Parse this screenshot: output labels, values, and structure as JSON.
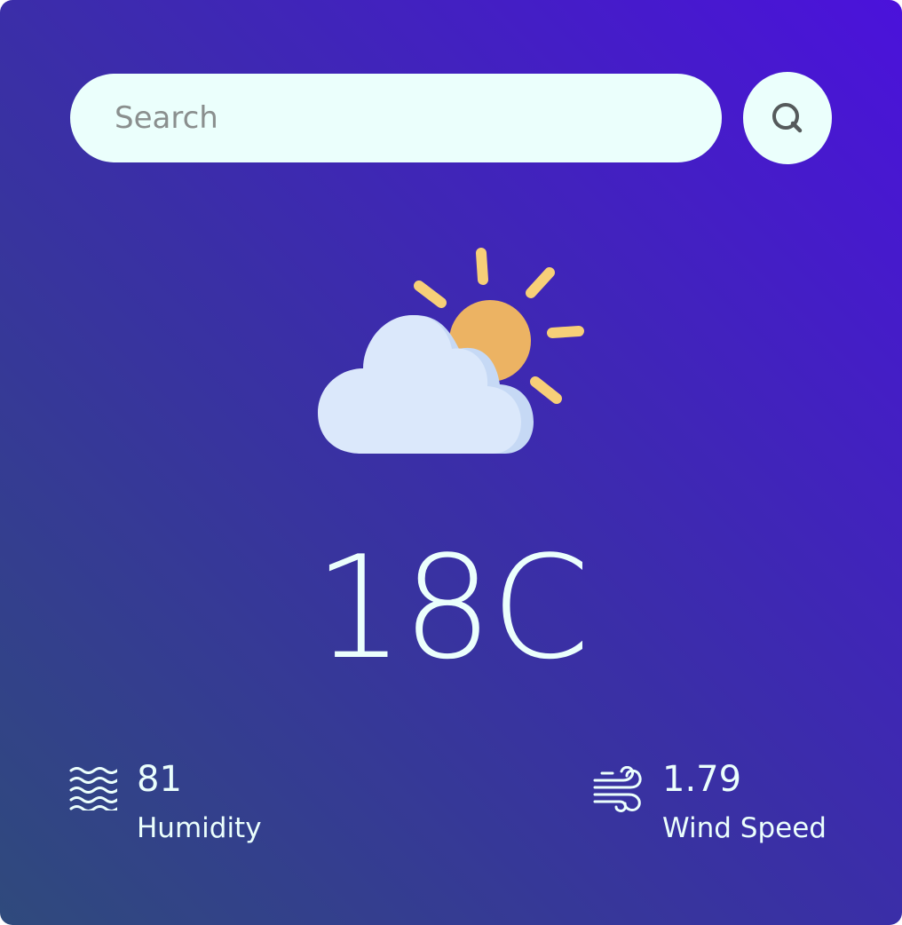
{
  "search": {
    "placeholder": "Search",
    "button_icon": "search-icon"
  },
  "weather": {
    "icon": "partly-cloudy-icon",
    "temperature": "18C"
  },
  "humidity": {
    "value": "81",
    "label": "Humidity",
    "icon": "humidity-waves-icon"
  },
  "wind": {
    "value": "1.79",
    "label": "Wind Speed",
    "icon": "wind-icon"
  },
  "colors": {
    "gradient_start": "#2f4a7c",
    "gradient_mid": "#3a2fa6",
    "gradient_end": "#4b12db",
    "text": "#ebfffc",
    "sun": "#ecb363",
    "sun_rays": "#f7cf78",
    "cloud": "#dbe8fb",
    "cloud_shade": "#c6d9f5"
  }
}
